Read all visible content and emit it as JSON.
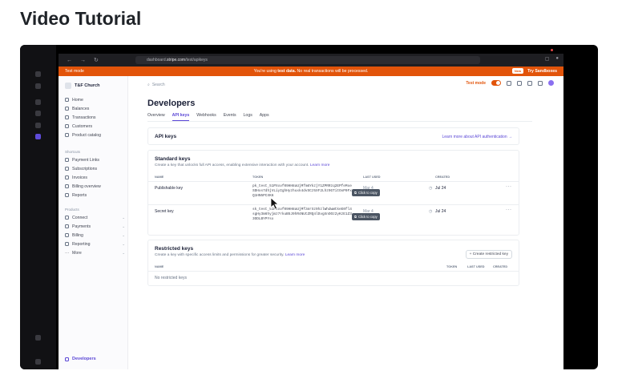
{
  "page": {
    "title": "Video Tutorial"
  },
  "browser": {
    "url_prefix": "dashboard.",
    "url_domain": "stripe.com",
    "url_path": "/test/apikeys"
  },
  "banner": {
    "left": "Test mode",
    "prefix": "You're using ",
    "bold": "test data.",
    "suffix": " No real transactions will be processed.",
    "new_badge": "New",
    "sandboxes": "Try Sandboxes"
  },
  "sidebar": {
    "account": "T&F Church",
    "main_items": [
      {
        "label": "Home"
      },
      {
        "label": "Balances"
      },
      {
        "label": "Transactions"
      },
      {
        "label": "Customers"
      },
      {
        "label": "Product catalog"
      }
    ],
    "shortcuts_heading": "Shortcuts",
    "shortcut_items": [
      {
        "label": "Payment Links"
      },
      {
        "label": "Subscriptions"
      },
      {
        "label": "Invoices"
      },
      {
        "label": "Billing overview"
      },
      {
        "label": "Reports"
      }
    ],
    "products_heading": "Products",
    "product_items": [
      {
        "label": "Connect"
      },
      {
        "label": "Payments"
      },
      {
        "label": "Billing"
      },
      {
        "label": "Reporting"
      },
      {
        "label": "More"
      }
    ],
    "developers": "Developers"
  },
  "topbar": {
    "search_placeholder": "Search",
    "test_mode": "Test mode"
  },
  "main": {
    "title": "Developers",
    "tabs": [
      {
        "label": "Overview"
      },
      {
        "label": "API keys"
      },
      {
        "label": "Webhooks"
      },
      {
        "label": "Events"
      },
      {
        "label": "Logs"
      },
      {
        "label": "Apps"
      }
    ],
    "api_keys_card": {
      "title": "API keys",
      "learn_more": "Learn more about API authentication →"
    },
    "standard": {
      "title": "Standard keys",
      "subtitle": "Create a key that unlocks full API access, enabling extensive interaction with your account.",
      "learn_more": "Learn more",
      "columns": {
        "name": "NAME",
        "token": "TOKEN",
        "last_used": "LAST USED",
        "created": "CREATED"
      },
      "rows": [
        {
          "name": "Publishable key",
          "token": "pk_test_51PXxvf09HH8aUjMfm6YkzjY1ZPRRzq2EPfeMxeSDHxs7dhjVLiyIghHyzhuxk4dvSCz5XF2Lhz9GTitOoP0FxQ1HN5PCXK6",
          "last_used": "Mar 4",
          "created": "Jul 24",
          "copy": "Click to copy"
        },
        {
          "name": "Secret key",
          "token": "sk_test_51PXxvf09HH8aUjMfzmrXz9hzlWhdwWtkeE0fl4sgHy3m6hyjmz7rkuB5J9hR4NUtZRQ4lDvgXnOOz2yKzE1Z33ODLBYPYsx",
          "last_used": "Mar 4",
          "created": "Jul 24",
          "copy": "Click to copy"
        }
      ]
    },
    "restricted": {
      "title": "Restricted keys",
      "subtitle": "Create a key with specific access limits and permissions for greater security.",
      "learn_more": "Learn more",
      "create_button": "+ Create restricted key",
      "columns": {
        "name": "NAME",
        "token": "TOKEN",
        "last_used": "LAST USED",
        "created": "CREATED"
      },
      "empty": "No restricted keys"
    }
  },
  "colors": {
    "accent": "#5b47d6",
    "test_orange": "#e2540a"
  }
}
